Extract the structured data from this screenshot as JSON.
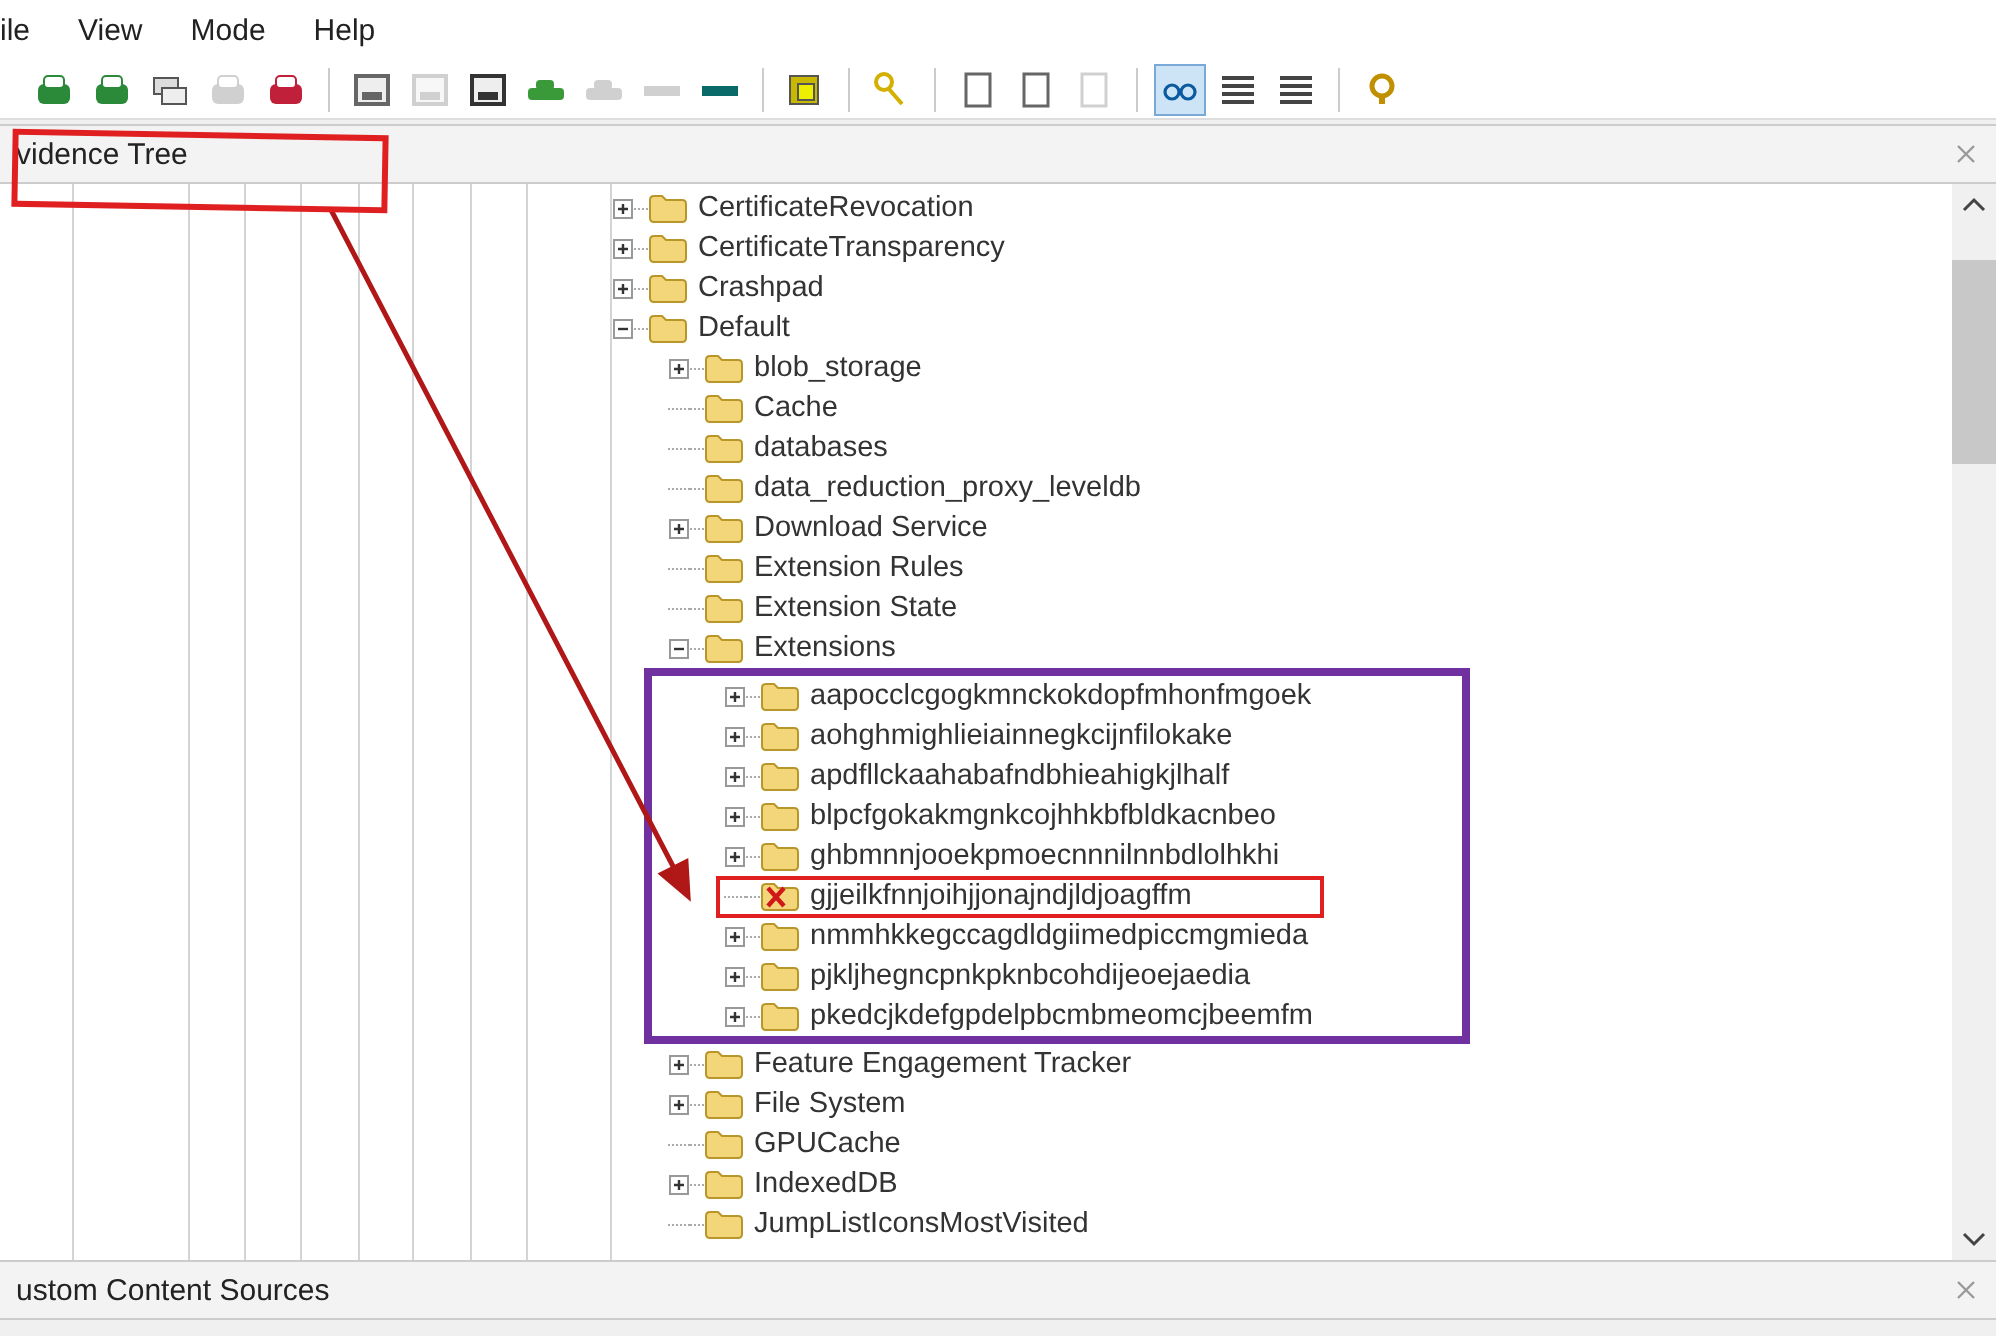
{
  "menu": [
    {
      "label": "ile"
    },
    {
      "label": "View"
    },
    {
      "label": "Mode"
    },
    {
      "label": "Help"
    }
  ],
  "toolbar_groups": [
    [
      {
        "disabled": false,
        "selected": false
      },
      {
        "disabled": false,
        "selected": false
      },
      {
        "disabled": false,
        "selected": false
      },
      {
        "disabled": true,
        "selected": false
      },
      {
        "disabled": false,
        "selected": false
      }
    ],
    [
      {
        "disabled": false,
        "selected": false
      },
      {
        "disabled": true,
        "selected": false
      },
      {
        "disabled": false,
        "selected": false
      },
      {
        "disabled": false,
        "selected": false
      },
      {
        "disabled": true,
        "selected": false
      },
      {
        "disabled": true,
        "selected": false
      },
      {
        "disabled": false,
        "selected": false
      }
    ],
    [
      {
        "disabled": false,
        "selected": false
      }
    ],
    [
      {
        "disabled": false,
        "selected": false
      }
    ],
    [
      {
        "disabled": false,
        "selected": false
      },
      {
        "disabled": false,
        "selected": false
      },
      {
        "disabled": true,
        "selected": false
      }
    ],
    [
      {
        "disabled": false,
        "selected": true
      },
      {
        "disabled": false,
        "selected": false
      },
      {
        "disabled": false,
        "selected": false
      }
    ],
    [
      {
        "disabled": false,
        "selected": false
      }
    ]
  ],
  "evidence_panel": {
    "title": "vidence Tree",
    "title_marked": true,
    "callout_arrow": true,
    "tree": [
      {
        "label": "CertificateRevocation",
        "expanded": false
      },
      {
        "label": "CertificateTransparency",
        "expanded": false
      },
      {
        "label": "Crashpad",
        "expanded": false
      },
      {
        "label": "Default",
        "expanded": true,
        "children": [
          {
            "label": "blob_storage",
            "expanded": false
          },
          {
            "label": "Cache"
          },
          {
            "label": "databases"
          },
          {
            "label": "data_reduction_proxy_leveldb"
          },
          {
            "label": "Download Service",
            "expanded": false
          },
          {
            "label": "Extension Rules"
          },
          {
            "label": "Extension State"
          },
          {
            "label": "Extensions",
            "expanded": true,
            "children_outlined": true,
            "children": [
              {
                "label": "aapocclcgogkmnckokdopfmhonfmgoek",
                "expanded": false
              },
              {
                "label": "aohghmighlieiainnegkcijnfilokake",
                "expanded": false
              },
              {
                "label": "apdfllckaahabafndbhieahigkjlhalf",
                "expanded": false
              },
              {
                "label": "blpcfgokakmgnkcojhhkbfbldkacnbeo",
                "expanded": false
              },
              {
                "label": "ghbmnnjooekpmoecnnnilnnbdlolhkhi",
                "expanded": false
              },
              {
                "label": "gjjeilkfnnjoihjjonajndjldjoagffm",
                "deleted": true,
                "marked": true
              },
              {
                "label": "nmmhkkegccagdldgiimedpiccmgmieda",
                "expanded": false
              },
              {
                "label": "pjkljhegncpnkpknbcohdijeoejaedia",
                "expanded": false
              },
              {
                "label": "pkedcjkdefgpdelpbcmbmeomcjbeemfm",
                "expanded": false
              }
            ]
          },
          {
            "label": "Feature Engagement Tracker",
            "expanded": false
          },
          {
            "label": "File System",
            "expanded": false
          },
          {
            "label": "GPUCache"
          },
          {
            "label": "IndexedDB",
            "expanded": false
          },
          {
            "label": "JumpListIconsMostVisited"
          }
        ]
      }
    ]
  },
  "custom_content_panel": {
    "title": "ustom Content Sources"
  }
}
